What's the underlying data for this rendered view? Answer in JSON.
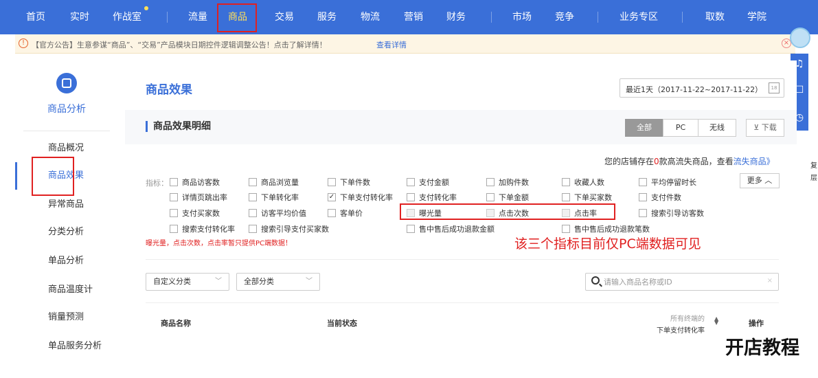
{
  "topnav": {
    "items": [
      "首页",
      "实时",
      "作战室",
      "流量",
      "商品",
      "交易",
      "服务",
      "物流",
      "营销",
      "财务",
      "市场",
      "竞争",
      "业务专区",
      "取数",
      "学院"
    ],
    "active": "商品"
  },
  "notice": {
    "icon": "info-icon",
    "text": "【官方公告】生意参谋“商品”、“交易”产品模块日期控件逻辑调整公告！点击了解详情！",
    "link": "查看详情"
  },
  "sidebar": {
    "title": "商品分析",
    "items": [
      "商品概况",
      "商品效果",
      "异常商品",
      "分类分析",
      "单品分析",
      "商品温度计",
      "销量预测",
      "单品服务分析"
    ],
    "active": "商品效果"
  },
  "header": {
    "title": "商品效果",
    "date_range": "最近1天（2017-11-22~2017-11-22）",
    "calendar_day": "18"
  },
  "section": {
    "title": "商品效果明细",
    "devices": [
      "全部",
      "PC",
      "无线"
    ],
    "device_active": "全部",
    "download": "下载"
  },
  "loss_notice": {
    "prefix": "您的店铺存在",
    "count": "0",
    "suffix": "款高流失商品，查看",
    "link": "流失商品》"
  },
  "metrics": {
    "label": "指标：",
    "more": "更多",
    "options": [
      {
        "label": "商品访客数",
        "checked": false
      },
      {
        "label": "商品浏览量",
        "checked": false
      },
      {
        "label": "下单件数",
        "checked": false
      },
      {
        "label": "支付金额",
        "checked": false
      },
      {
        "label": "加购件数",
        "checked": false
      },
      {
        "label": "收藏人数",
        "checked": false
      },
      {
        "label": "平均停留时长",
        "checked": false
      },
      {
        "label": "详情页跳出率",
        "checked": false
      },
      {
        "label": "下单转化率",
        "checked": false
      },
      {
        "label": "下单支付转化率",
        "checked": true
      },
      {
        "label": "支付转化率",
        "checked": false
      },
      {
        "label": "下单金额",
        "checked": false
      },
      {
        "label": "下单买家数",
        "checked": false
      },
      {
        "label": "支付件数",
        "checked": false
      },
      {
        "label": "支付买家数",
        "checked": false
      },
      {
        "label": "访客平均价值",
        "checked": false
      },
      {
        "label": "客单价",
        "checked": false
      },
      {
        "label": "曝光量",
        "checked": false
      },
      {
        "label": "点击次数",
        "checked": false
      },
      {
        "label": "点击率",
        "checked": false
      },
      {
        "label": "搜索引导访客数",
        "checked": false
      },
      {
        "label": "搜索支付转化率",
        "checked": false
      },
      {
        "label": "搜索引导支付买家数",
        "checked": false
      },
      {
        "label": "售中售后成功退款金额",
        "checked": false
      },
      {
        "label": "售中售后成功退款笔数",
        "checked": false
      }
    ],
    "note": "曝光量，点击次数，点击率暂只提供PC端数据！",
    "annotation": "该三个指标目前仅PC端数据可见"
  },
  "filters": {
    "category_select": "自定义分类",
    "all_select": "全部分类",
    "search_placeholder": "请输入商品名称或ID"
  },
  "table": {
    "col_name": "商品名称",
    "col_status": "当前状态",
    "col_rate_top": "所有终端的",
    "col_rate": "下单支付转化率",
    "col_action": "操作"
  },
  "watermark": "开店教程",
  "edge_labels": [
    "复",
    "层"
  ],
  "colors": {
    "brand": "#3a6fd8",
    "highlight": "#e02020",
    "active_nav": "#ffe05a"
  }
}
